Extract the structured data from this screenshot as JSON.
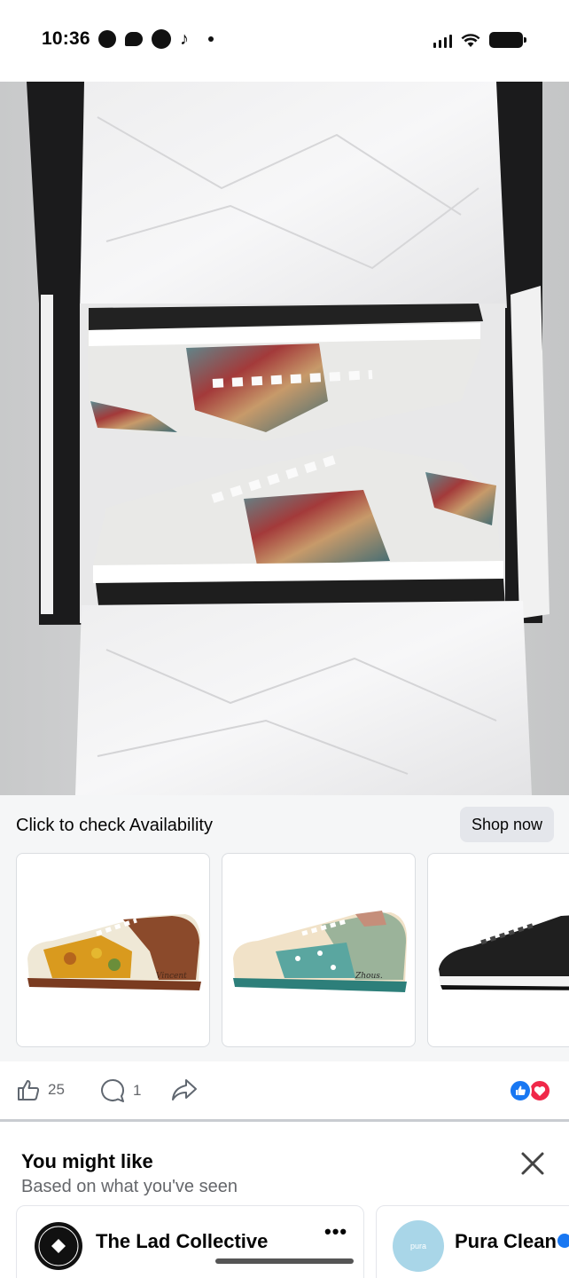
{
  "status_bar": {
    "time": "10:36",
    "left_icons": [
      "messenger-icon",
      "chat-bubble-icon",
      "globe-icon",
      "tiktok-icon",
      "dot-icon"
    ],
    "right_icons": [
      "signal-icon",
      "wifi-icon",
      "battery-icon"
    ]
  },
  "ad": {
    "cta_text": "Click to check Availability",
    "shop_button": "Shop now",
    "carousel_items": [
      "sunflower-sneaker",
      "almond-blossom-sneaker",
      "black-embossed-sneaker"
    ],
    "signature_1": "Vincent",
    "signature_2": "Zhous."
  },
  "engagement": {
    "likes": "25",
    "comments": "1",
    "reactions": [
      "like",
      "love"
    ]
  },
  "you_might_like": {
    "title": "You might like",
    "subtitle": "Based on what you've seen",
    "pages": [
      {
        "name": "The Lad Collective",
        "avatar_text": "THE LAD COLLECTIVE"
      },
      {
        "name": "Pura Clean",
        "avatar_text": "pura"
      }
    ],
    "more": "•••"
  },
  "colors": {
    "accent_blue": "#1877f2",
    "love_red": "#f02849",
    "cta_background": "#f5f6f7",
    "button_gray": "#e4e6eb"
  }
}
